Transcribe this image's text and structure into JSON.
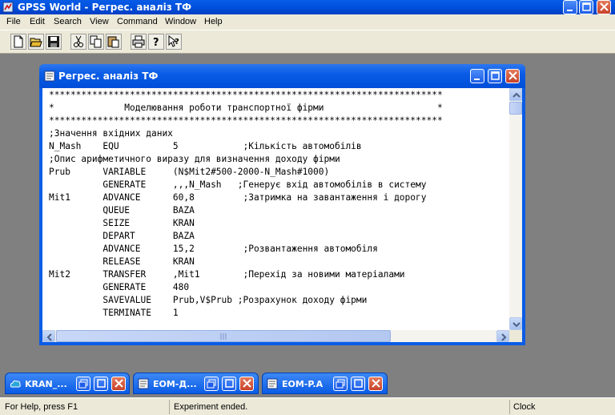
{
  "app": {
    "title": "GPSS World - Регрес. аналіз ТФ"
  },
  "menu": [
    "File",
    "Edit",
    "Search",
    "View",
    "Command",
    "Window",
    "Help"
  ],
  "toolbar": {
    "icons": [
      "new-icon",
      "open-icon",
      "save-icon",
      "cut-icon",
      "copy-icon",
      "paste-icon",
      "print-icon",
      "help-icon",
      "context-help-icon"
    ]
  },
  "document": {
    "title": "Регрес. аналіз ТФ",
    "lines": [
      "*************************************************************************",
      "*             Моделювання роботи транспортної фірми                     *",
      "*************************************************************************",
      ";Значення вхідних даних",
      "N_Mash    EQU          5            ;Кількість автомобілів",
      ";Опис арифметичного виразу для визначення доходу фірми",
      "Prub      VARIABLE     (N$Mit2#500-2000-N_Mash#1000)",
      "          GENERATE     ,,,N_Mash   ;Генерує вхід автомобілів в систему",
      "Mit1      ADVANCE      60,8         ;Затримка на завантаження і дорогу",
      "          QUEUE        BAZA",
      "          SEIZE        KRAN",
      "          DEPART       BAZA",
      "          ADVANCE      15,2         ;Розвантаження автомобіля",
      "          RELEASE      KRAN",
      "Mit2      TRANSFER     ,Mit1        ;Перехід за новими матеріалами",
      "          GENERATE     480",
      "          SAVEVALUE    Prub,V$Prub ;Розрахунок доходу фірми",
      "          TERMINATE    1"
    ]
  },
  "minimized": [
    {
      "label": "KRAN_..."
    },
    {
      "label": "EOM-Д..."
    },
    {
      "label": "EOM-P.A"
    }
  ],
  "status": {
    "help": "For Help, press F1",
    "message": "Experiment ended.",
    "clock": "Clock"
  }
}
